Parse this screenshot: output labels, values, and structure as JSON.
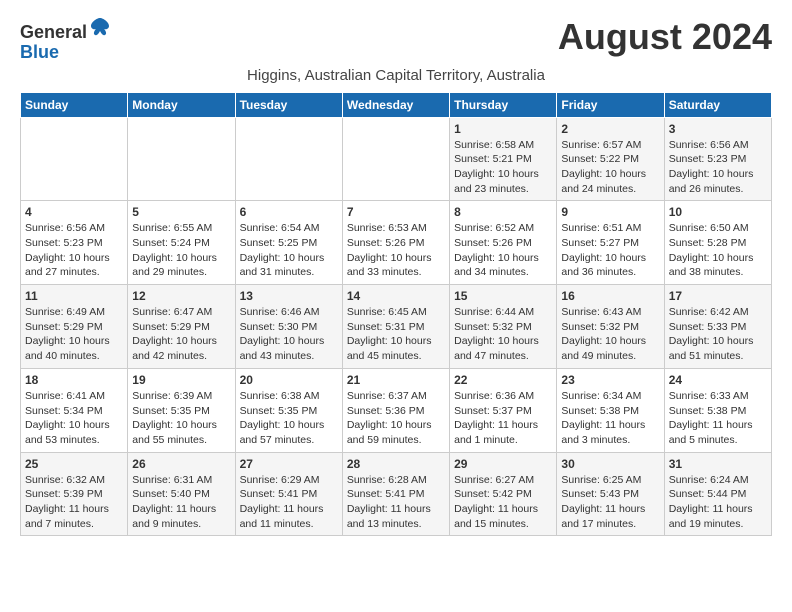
{
  "app": {
    "logo_general": "General",
    "logo_blue": "Blue"
  },
  "header": {
    "title": "August 2024",
    "subtitle": "Higgins, Australian Capital Territory, Australia"
  },
  "calendar": {
    "days_of_week": [
      "Sunday",
      "Monday",
      "Tuesday",
      "Wednesday",
      "Thursday",
      "Friday",
      "Saturday"
    ],
    "weeks": [
      [
        {
          "day": "",
          "info": ""
        },
        {
          "day": "",
          "info": ""
        },
        {
          "day": "",
          "info": ""
        },
        {
          "day": "",
          "info": ""
        },
        {
          "day": "1",
          "info": "Sunrise: 6:58 AM\nSunset: 5:21 PM\nDaylight: 10 hours\nand 23 minutes."
        },
        {
          "day": "2",
          "info": "Sunrise: 6:57 AM\nSunset: 5:22 PM\nDaylight: 10 hours\nand 24 minutes."
        },
        {
          "day": "3",
          "info": "Sunrise: 6:56 AM\nSunset: 5:23 PM\nDaylight: 10 hours\nand 26 minutes."
        }
      ],
      [
        {
          "day": "4",
          "info": "Sunrise: 6:56 AM\nSunset: 5:23 PM\nDaylight: 10 hours\nand 27 minutes."
        },
        {
          "day": "5",
          "info": "Sunrise: 6:55 AM\nSunset: 5:24 PM\nDaylight: 10 hours\nand 29 minutes."
        },
        {
          "day": "6",
          "info": "Sunrise: 6:54 AM\nSunset: 5:25 PM\nDaylight: 10 hours\nand 31 minutes."
        },
        {
          "day": "7",
          "info": "Sunrise: 6:53 AM\nSunset: 5:26 PM\nDaylight: 10 hours\nand 33 minutes."
        },
        {
          "day": "8",
          "info": "Sunrise: 6:52 AM\nSunset: 5:26 PM\nDaylight: 10 hours\nand 34 minutes."
        },
        {
          "day": "9",
          "info": "Sunrise: 6:51 AM\nSunset: 5:27 PM\nDaylight: 10 hours\nand 36 minutes."
        },
        {
          "day": "10",
          "info": "Sunrise: 6:50 AM\nSunset: 5:28 PM\nDaylight: 10 hours\nand 38 minutes."
        }
      ],
      [
        {
          "day": "11",
          "info": "Sunrise: 6:49 AM\nSunset: 5:29 PM\nDaylight: 10 hours\nand 40 minutes."
        },
        {
          "day": "12",
          "info": "Sunrise: 6:47 AM\nSunset: 5:29 PM\nDaylight: 10 hours\nand 42 minutes."
        },
        {
          "day": "13",
          "info": "Sunrise: 6:46 AM\nSunset: 5:30 PM\nDaylight: 10 hours\nand 43 minutes."
        },
        {
          "day": "14",
          "info": "Sunrise: 6:45 AM\nSunset: 5:31 PM\nDaylight: 10 hours\nand 45 minutes."
        },
        {
          "day": "15",
          "info": "Sunrise: 6:44 AM\nSunset: 5:32 PM\nDaylight: 10 hours\nand 47 minutes."
        },
        {
          "day": "16",
          "info": "Sunrise: 6:43 AM\nSunset: 5:32 PM\nDaylight: 10 hours\nand 49 minutes."
        },
        {
          "day": "17",
          "info": "Sunrise: 6:42 AM\nSunset: 5:33 PM\nDaylight: 10 hours\nand 51 minutes."
        }
      ],
      [
        {
          "day": "18",
          "info": "Sunrise: 6:41 AM\nSunset: 5:34 PM\nDaylight: 10 hours\nand 53 minutes."
        },
        {
          "day": "19",
          "info": "Sunrise: 6:39 AM\nSunset: 5:35 PM\nDaylight: 10 hours\nand 55 minutes."
        },
        {
          "day": "20",
          "info": "Sunrise: 6:38 AM\nSunset: 5:35 PM\nDaylight: 10 hours\nand 57 minutes."
        },
        {
          "day": "21",
          "info": "Sunrise: 6:37 AM\nSunset: 5:36 PM\nDaylight: 10 hours\nand 59 minutes."
        },
        {
          "day": "22",
          "info": "Sunrise: 6:36 AM\nSunset: 5:37 PM\nDaylight: 11 hours\nand 1 minute."
        },
        {
          "day": "23",
          "info": "Sunrise: 6:34 AM\nSunset: 5:38 PM\nDaylight: 11 hours\nand 3 minutes."
        },
        {
          "day": "24",
          "info": "Sunrise: 6:33 AM\nSunset: 5:38 PM\nDaylight: 11 hours\nand 5 minutes."
        }
      ],
      [
        {
          "day": "25",
          "info": "Sunrise: 6:32 AM\nSunset: 5:39 PM\nDaylight: 11 hours\nand 7 minutes."
        },
        {
          "day": "26",
          "info": "Sunrise: 6:31 AM\nSunset: 5:40 PM\nDaylight: 11 hours\nand 9 minutes."
        },
        {
          "day": "27",
          "info": "Sunrise: 6:29 AM\nSunset: 5:41 PM\nDaylight: 11 hours\nand 11 minutes."
        },
        {
          "day": "28",
          "info": "Sunrise: 6:28 AM\nSunset: 5:41 PM\nDaylight: 11 hours\nand 13 minutes."
        },
        {
          "day": "29",
          "info": "Sunrise: 6:27 AM\nSunset: 5:42 PM\nDaylight: 11 hours\nand 15 minutes."
        },
        {
          "day": "30",
          "info": "Sunrise: 6:25 AM\nSunset: 5:43 PM\nDaylight: 11 hours\nand 17 minutes."
        },
        {
          "day": "31",
          "info": "Sunrise: 6:24 AM\nSunset: 5:44 PM\nDaylight: 11 hours\nand 19 minutes."
        }
      ]
    ]
  }
}
